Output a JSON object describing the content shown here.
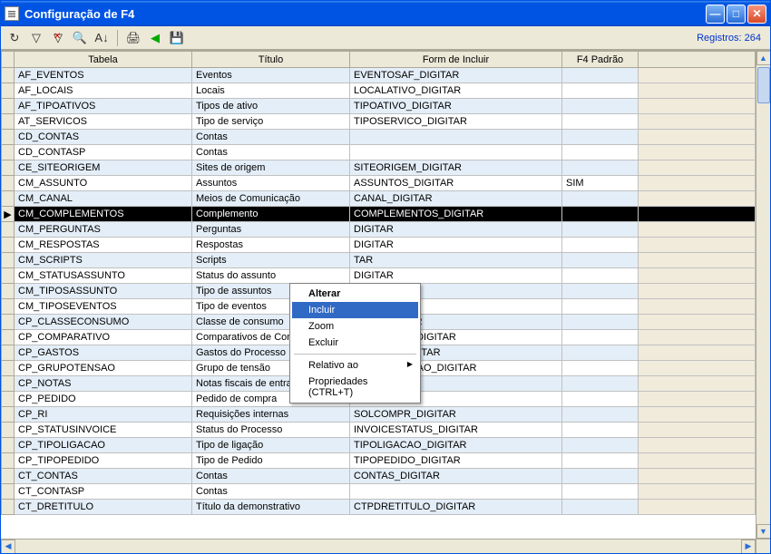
{
  "window": {
    "title": "Configuração de F4"
  },
  "toolbar": {
    "records_label": "Registros: 264",
    "icons": [
      "refresh",
      "filter",
      "clear-filter",
      "find",
      "sort",
      "print",
      "prev",
      "save"
    ]
  },
  "columns": [
    "Tabela",
    "Título",
    "Form de Incluir",
    "F4 Padrão",
    ""
  ],
  "rows": [
    {
      "tabela": "AF_EVENTOS",
      "titulo": "Eventos",
      "form": "EVENTOSAF_DIGITAR",
      "padrao": ""
    },
    {
      "tabela": "AF_LOCAIS",
      "titulo": "Locais",
      "form": "LOCALATIVO_DIGITAR",
      "padrao": ""
    },
    {
      "tabela": "AF_TIPOATIVOS",
      "titulo": "Tipos de ativo",
      "form": "TIPOATIVO_DIGITAR",
      "padrao": ""
    },
    {
      "tabela": "AT_SERVICOS",
      "titulo": "Tipo de serviço",
      "form": "TIPOSERVICO_DIGITAR",
      "padrao": ""
    },
    {
      "tabela": "CD_CONTAS",
      "titulo": "Contas",
      "form": "",
      "padrao": ""
    },
    {
      "tabela": "CD_CONTASP",
      "titulo": "Contas",
      "form": "",
      "padrao": ""
    },
    {
      "tabela": "CE_SITEORIGEM",
      "titulo": "Sites de origem",
      "form": "SITEORIGEM_DIGITAR",
      "padrao": ""
    },
    {
      "tabela": "CM_ASSUNTO",
      "titulo": "Assuntos",
      "form": "ASSUNTOS_DIGITAR",
      "padrao": "SIM"
    },
    {
      "tabela": "CM_CANAL",
      "titulo": "Meios de Comunicação",
      "form": "CANAL_DIGITAR",
      "padrao": ""
    },
    {
      "tabela": "CM_COMPLEMENTOS",
      "titulo": "Complemento",
      "form": "COMPLEMENTOS_DIGITAR",
      "padrao": "",
      "selected": true,
      "marker": "▶"
    },
    {
      "tabela": "CM_PERGUNTAS",
      "titulo": "Perguntas",
      "form": "DIGITAR",
      "padrao": ""
    },
    {
      "tabela": "CM_RESPOSTAS",
      "titulo": "Respostas",
      "form": "DIGITAR",
      "padrao": ""
    },
    {
      "tabela": "CM_SCRIPTS",
      "titulo": "Scripts",
      "form": "TAR",
      "padrao": ""
    },
    {
      "tabela": "CM_STATUSASSUNTO",
      "titulo": "Status do assunto",
      "form": "DIGITAR",
      "padrao": ""
    },
    {
      "tabela": "CM_TIPOSASSUNTO",
      "titulo": "Tipo de assuntos",
      "form": "S_DIGITAR",
      "padrao": ""
    },
    {
      "tabela": "CM_TIPOSEVENTOS",
      "titulo": "Tipo de eventos",
      "form": "S_DIGITAR",
      "padrao": ""
    },
    {
      "tabela": "CP_CLASSECONSUMO",
      "titulo": "Classe de consumo",
      "form": "UMO_DIGITAR",
      "padrao": ""
    },
    {
      "tabela": "CP_COMPARATIVO",
      "titulo": "Comparativos de Compra",
      "form": "SOLCOMPR_DIGITAR",
      "padrao": ""
    },
    {
      "tabela": "CP_GASTOS",
      "titulo": "Gastos do Processo",
      "form": "GASTOS_DIGITAR",
      "padrao": ""
    },
    {
      "tabela": "CP_GRUPOTENSAO",
      "titulo": "Grupo de tensão",
      "form": "GRUPOTENSAO_DIGITAR",
      "padrao": ""
    },
    {
      "tabela": "CP_NOTAS",
      "titulo": "Notas fiscais de entrada",
      "form": "",
      "padrao": ""
    },
    {
      "tabela": "CP_PEDIDO",
      "titulo": "Pedido de compra",
      "form": "",
      "padrao": ""
    },
    {
      "tabela": "CP_RI",
      "titulo": "Requisições internas",
      "form": "SOLCOMPR_DIGITAR",
      "padrao": ""
    },
    {
      "tabela": "CP_STATUSINVOICE",
      "titulo": "Status do Processo",
      "form": "INVOICESTATUS_DIGITAR",
      "padrao": ""
    },
    {
      "tabela": "CP_TIPOLIGACAO",
      "titulo": "Tipo de ligação",
      "form": "TIPOLIGACAO_DIGITAR",
      "padrao": ""
    },
    {
      "tabela": "CP_TIPOPEDIDO",
      "titulo": "Tipo de Pedido",
      "form": "TIPOPEDIDO_DIGITAR",
      "padrao": ""
    },
    {
      "tabela": "CT_CONTAS",
      "titulo": "Contas",
      "form": "CONTAS_DIGITAR",
      "padrao": ""
    },
    {
      "tabela": "CT_CONTASP",
      "titulo": "Contas",
      "form": "",
      "padrao": ""
    },
    {
      "tabela": "CT_DRETITULO",
      "titulo": "Título da demonstrativo",
      "form": "CTPDRETITULO_DIGITAR",
      "padrao": ""
    }
  ],
  "context_menu": {
    "items": [
      {
        "label": "Alterar",
        "bold": true
      },
      {
        "label": "Incluir",
        "highlight": true
      },
      {
        "label": "Zoom"
      },
      {
        "label": "Excluir"
      },
      {
        "sep": true
      },
      {
        "label": "Relativo ao",
        "submenu": true
      },
      {
        "label": "Propriedades (CTRL+T)"
      }
    ]
  }
}
